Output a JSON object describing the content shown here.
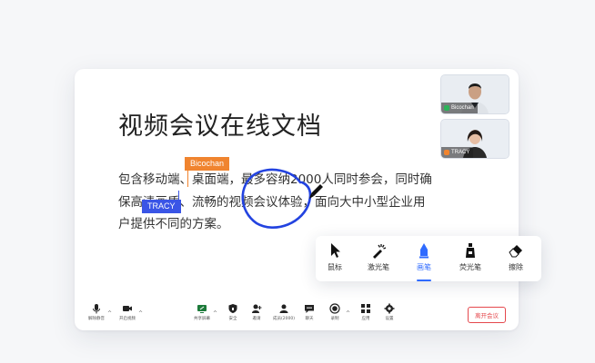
{
  "document": {
    "title": "视频会议在线文档",
    "lines": [
      "包含移动端、桌面端，最多容纳2000人同时参会，同时确",
      "保高清画质、流畅的视频会议体验，面向大中小型企业用",
      "户提供不同的方案。"
    ]
  },
  "cursors": [
    {
      "name": "Bicochan",
      "color": "#f0842f"
    },
    {
      "name": "TRACY",
      "color": "#3a55e6"
    }
  ],
  "participants": [
    {
      "name": "Bicochan",
      "mic_color": "#2cb35a"
    },
    {
      "name": "TRACY",
      "mic_color": "#f0842f"
    }
  ],
  "annotation_tools": {
    "items": [
      {
        "label": "鼠标",
        "icon": "mouse-pointer-icon"
      },
      {
        "label": "激光笔",
        "icon": "laser-pointer-icon"
      },
      {
        "label": "画笔",
        "icon": "pen-icon",
        "active": true
      },
      {
        "label": "荧光笔",
        "icon": "highlighter-icon"
      },
      {
        "label": "擦除",
        "icon": "eraser-icon"
      }
    ],
    "active_color": "#2f6bff"
  },
  "toolbar": {
    "mute": "解除静音",
    "video": "开启视频",
    "share": "共享屏幕",
    "security": "安全",
    "invite": "邀请",
    "members": "成员(2000)",
    "chat": "聊天",
    "record": "录制",
    "apps": "应用",
    "settings": "设置",
    "leave": "离开会议"
  }
}
